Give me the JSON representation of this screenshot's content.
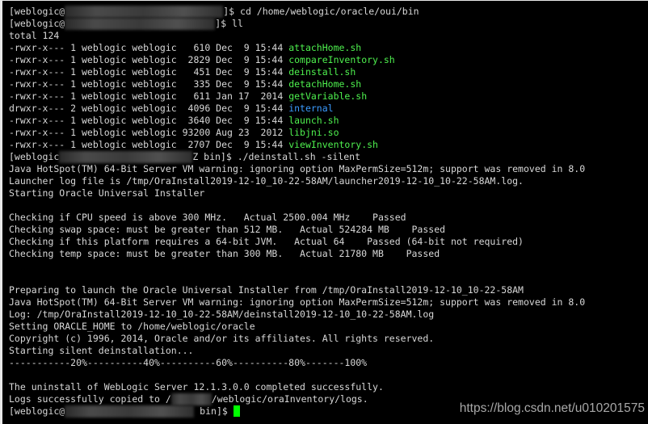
{
  "terminal": {
    "colors": {
      "text": "#d8d8d8",
      "executable": "#4ef04e",
      "directory": "#3b9cff",
      "cursor": "#00ff00",
      "background": "#000000"
    },
    "lines": [
      [
        {
          "t": "[weblogic@"
        },
        {
          "redact": 0
        },
        {
          "t": "]$ cd /home/weblogic/oracle/oui/bin"
        }
      ],
      [
        {
          "t": "[weblogic@"
        },
        {
          "redact": 1
        },
        {
          "t": "]$ ll"
        }
      ],
      [
        {
          "t": "total 124"
        }
      ],
      [
        {
          "t": "-rwxr-x--- 1 weblogic weblogic   610 Dec  9 15:44 "
        },
        {
          "t": "attachHome.sh",
          "c": "green"
        }
      ],
      [
        {
          "t": "-rwxr-x--- 1 weblogic weblogic  2829 Dec  9 15:44 "
        },
        {
          "t": "compareInventory.sh",
          "c": "green"
        }
      ],
      [
        {
          "t": "-rwxr-x--- 1 weblogic weblogic   451 Dec  9 15:44 "
        },
        {
          "t": "deinstall.sh",
          "c": "green"
        }
      ],
      [
        {
          "t": "-rwxr-x--- 1 weblogic weblogic   335 Dec  9 15:44 "
        },
        {
          "t": "detachHome.sh",
          "c": "green"
        }
      ],
      [
        {
          "t": "-rwxr-x--- 1 weblogic weblogic   611 Jan 17  2014 "
        },
        {
          "t": "getVariable.sh",
          "c": "green"
        }
      ],
      [
        {
          "t": "drwxr-x--- 2 weblogic weblogic  4096 Dec  9 15:44 "
        },
        {
          "t": "internal",
          "c": "blue"
        }
      ],
      [
        {
          "t": "-rwxr-x--- 1 weblogic weblogic  3640 Dec  9 15:44 "
        },
        {
          "t": "launch.sh",
          "c": "green"
        }
      ],
      [
        {
          "t": "-rwxr-x--- 1 weblogic weblogic 93200 Aug 23  2012 "
        },
        {
          "t": "libjni.so",
          "c": "green"
        }
      ],
      [
        {
          "t": "-rwxr-x--- 1 weblogic weblogic  2707 Dec  9 15:44 "
        },
        {
          "t": "viewInventory.sh",
          "c": "green"
        }
      ],
      [
        {
          "t": "[weblogic"
        },
        {
          "redact": 2
        },
        {
          "t": "Z bin]$ ./deinstall.sh -silent"
        }
      ],
      [
        {
          "t": "Java HotSpot(TM) 64-Bit Server VM warning: ignoring option MaxPermSize=512m; support was removed in 8.0"
        }
      ],
      [
        {
          "t": "Launcher log file is /tmp/OraInstall2019-12-10_10-22-58AM/launcher2019-12-10_10-22-58AM.log."
        }
      ],
      [
        {
          "t": "Starting Oracle Universal Installer"
        }
      ],
      [],
      [
        {
          "t": "Checking if CPU speed is above 300 MHz.   Actual 2500.004 MHz    Passed"
        }
      ],
      [
        {
          "t": "Checking swap space: must be greater than 512 MB.   Actual 524284 MB    Passed"
        }
      ],
      [
        {
          "t": "Checking if this platform requires a 64-bit JVM.   Actual 64    Passed (64-bit not required)"
        }
      ],
      [
        {
          "t": "Checking temp space: must be greater than 300 MB.   Actual 21780 MB    Passed"
        }
      ],
      [],
      [],
      [
        {
          "t": "Preparing to launch the Oracle Universal Installer from /tmp/OraInstall2019-12-10_10-22-58AM"
        }
      ],
      [
        {
          "t": "Java HotSpot(TM) 64-Bit Server VM warning: ignoring option MaxPermSize=512m; support was removed in 8.0"
        }
      ],
      [
        {
          "t": "Log: /tmp/OraInstall2019-12-10_10-22-58AM/deinstall2019-12-10_10-22-58AM.log"
        }
      ],
      [
        {
          "t": "Setting ORACLE_HOME to /home/weblogic/oracle"
        }
      ],
      [
        {
          "t": "Copyright (c) 1996, 2014, Oracle and/or its affiliates. All rights reserved."
        }
      ],
      [
        {
          "t": "Starting silent deinstallation..."
        }
      ],
      [
        {
          "t": "-----------20%----------40%----------60%----------80%-------100%"
        }
      ],
      [],
      [
        {
          "t": "The uninstall of WebLogic Server 12.1.3.0.0 completed successfully."
        }
      ],
      [
        {
          "t": "Logs successfully copied to /"
        },
        {
          "redact": 3
        },
        {
          "t": "/weblogic/oraInventory/logs."
        }
      ],
      [
        {
          "t": "[weblogic@"
        },
        {
          "redact": 4
        },
        {
          "t": " bin]$ "
        },
        {
          "cursor": true
        }
      ]
    ]
  },
  "watermark": "https://blog.csdn.net/u010201575"
}
